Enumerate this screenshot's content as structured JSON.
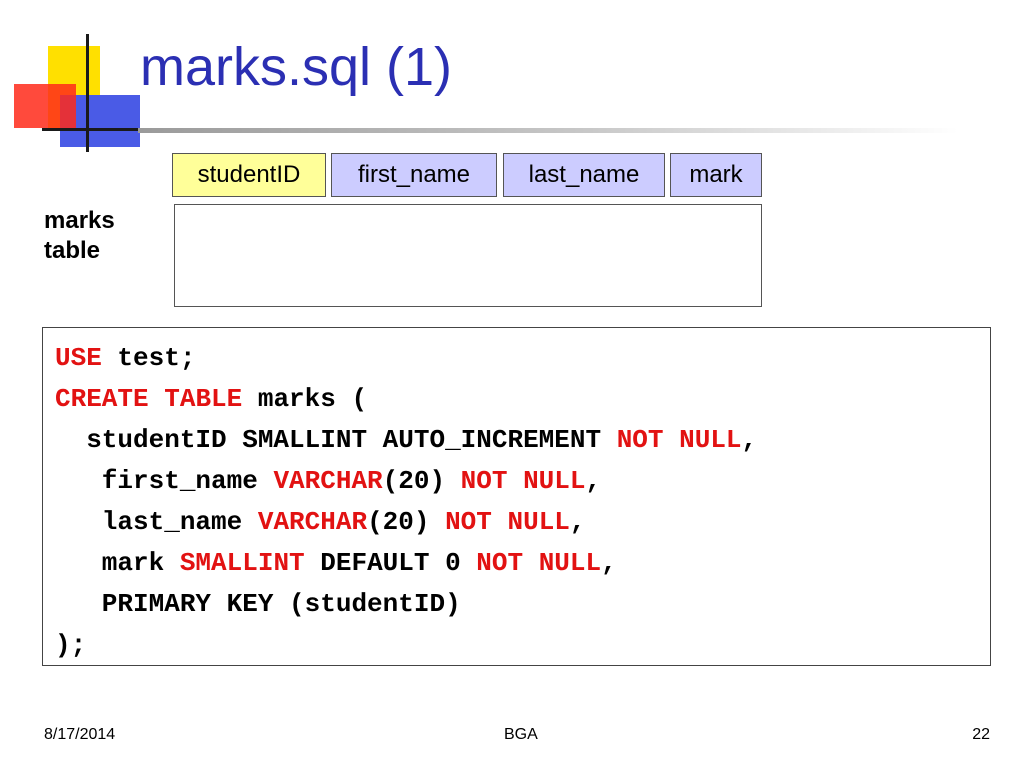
{
  "slide": {
    "title": "marks.sql (1)",
    "table_headers": [
      "studentID",
      "first_name",
      "last_name",
      "mark"
    ],
    "table_label_line1": "marks",
    "table_label_line2": "table"
  },
  "code": {
    "l1_kw": "USE",
    "l1_rest": " test;",
    "l2_kw1": "CREATE",
    "l2_kw2": "TABLE",
    "l2_rest": " marks (",
    "l3_plain": "  studentID SMALLINT AUTO_INCREMENT ",
    "l3_kw": "NOT NULL",
    "l3_tail": ",",
    "l4_indent": "   first_name ",
    "l4_kw1": "VARCHAR",
    "l4_mid": "(20) ",
    "l4_kw2": "NOT NULL",
    "l4_tail": ",",
    "l5_indent": "   last_name ",
    "l5_kw1": "VARCHAR",
    "l5_mid": "(20) ",
    "l5_kw2": "NOT NULL",
    "l5_tail": ",",
    "l6_indent": "   mark ",
    "l6_kw1": "SMALLINT",
    "l6_mid": " DEFAULT 0 ",
    "l6_kw2": "NOT NULL",
    "l6_tail": ",",
    "l7": "   PRIMARY KEY (studentID)",
    "l8": ");"
  },
  "footer": {
    "date": "8/17/2014",
    "center": "BGA",
    "page": "22"
  },
  "colors": {
    "title": "#2b2fb3",
    "keyword": "#e21212",
    "header_primary_key": "#ffff99",
    "header_other": "#ccccff"
  }
}
